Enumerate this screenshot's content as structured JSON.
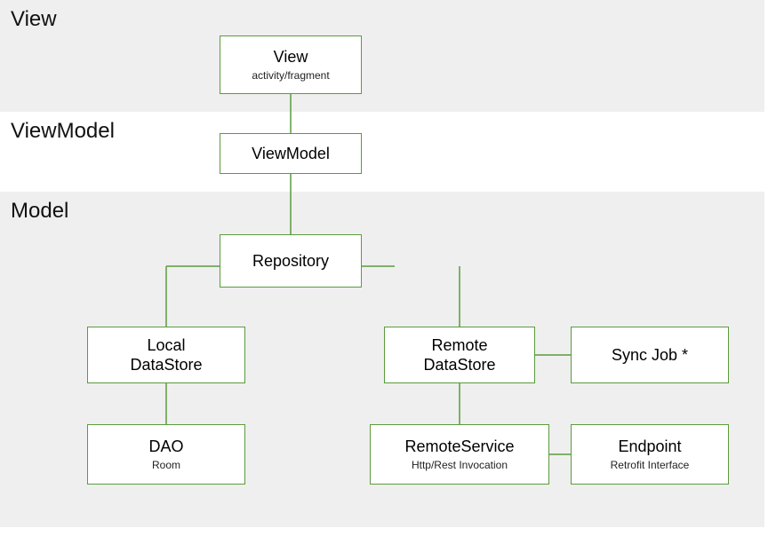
{
  "layers": {
    "view": {
      "label": "View"
    },
    "viewmodel": {
      "label": "ViewModel"
    },
    "model": {
      "label": "Model"
    }
  },
  "boxes": {
    "view": {
      "title": "View",
      "sub": "activity/fragment"
    },
    "viewmodel": {
      "title": "ViewModel",
      "sub": ""
    },
    "repository": {
      "title": "Repository",
      "sub": ""
    },
    "local_ds": {
      "title": "Local\nDataStore",
      "sub": ""
    },
    "remote_ds": {
      "title": "Remote\nDataStore",
      "sub": ""
    },
    "sync_job": {
      "title": "Sync Job *",
      "sub": ""
    },
    "dao": {
      "title": "DAO",
      "sub": "Room"
    },
    "remote_svc": {
      "title": "RemoteService",
      "sub": "Http/Rest Invocation"
    },
    "endpoint": {
      "title": "Endpoint",
      "sub": "Retrofit Interface"
    }
  }
}
